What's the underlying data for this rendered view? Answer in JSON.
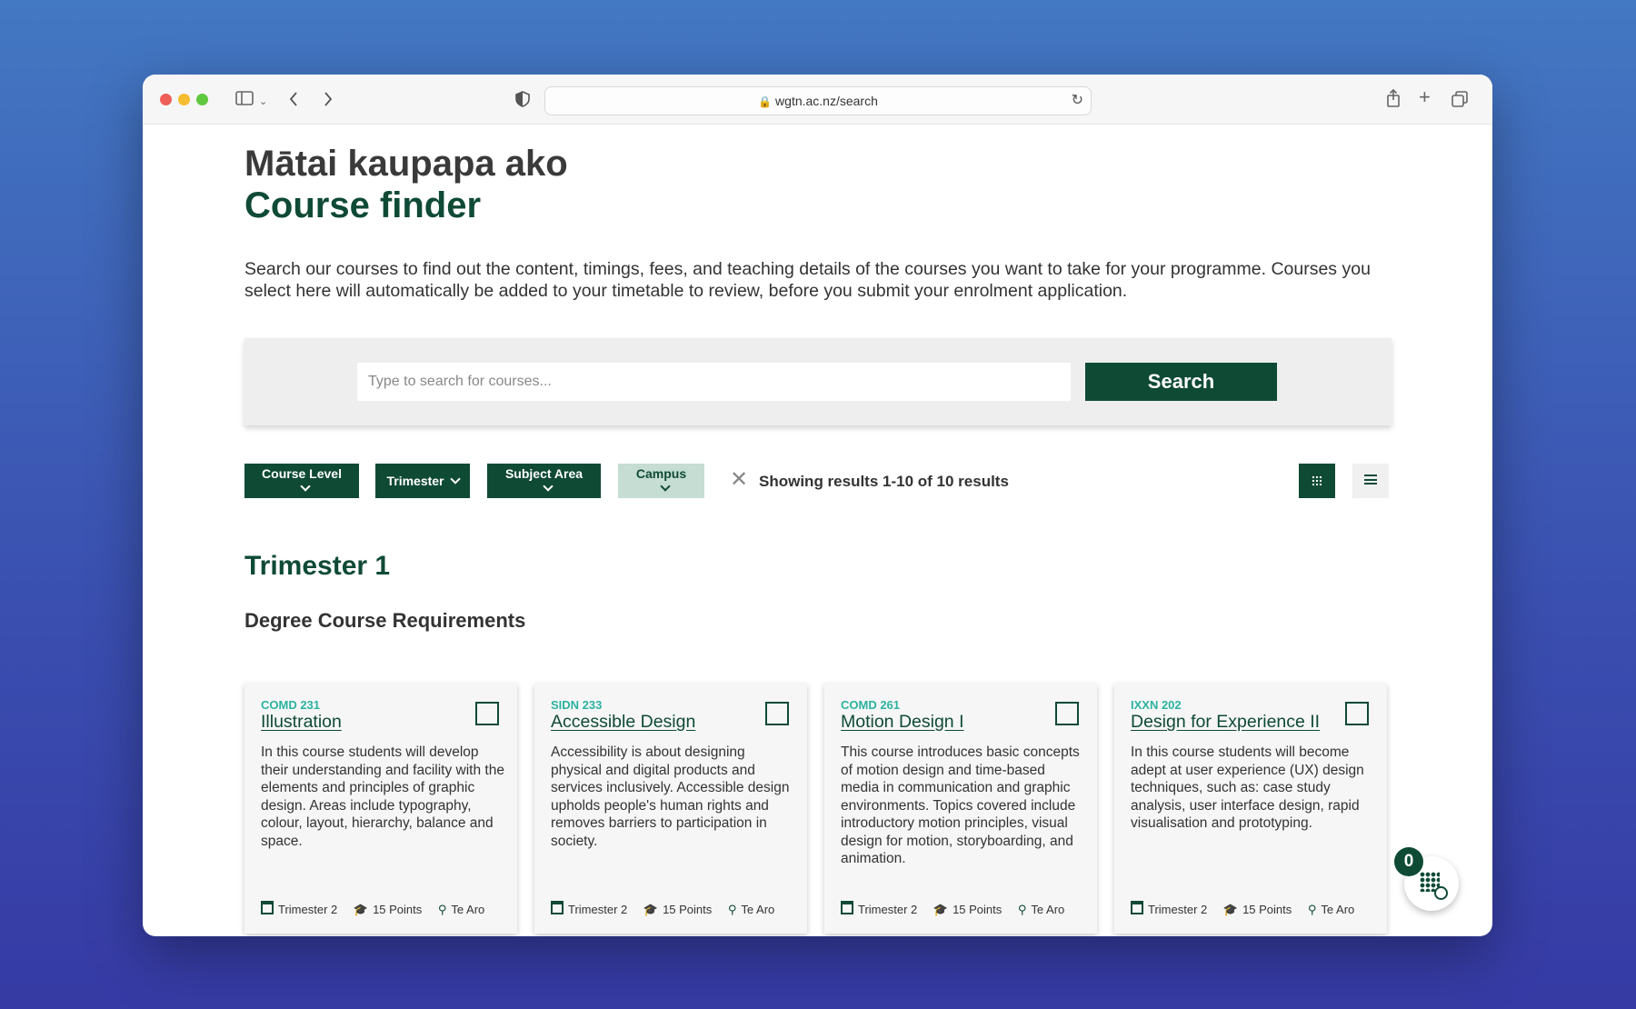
{
  "browser": {
    "url": "wgtn.ac.nz/search"
  },
  "page": {
    "heading_maori": "Mātai kaupapa ako",
    "heading": "Course finder",
    "intro": "Search our courses to find out the content, timings, fees, and teaching details of the courses you want to take for your programme. Courses you select here will automatically be added to your timetable to review, before you submit your enrolment application."
  },
  "search": {
    "placeholder": "Type to search for courses...",
    "button_label": "Search"
  },
  "filters": {
    "items": [
      {
        "label": "Course Level"
      },
      {
        "label": "Trimester"
      },
      {
        "label": "Subject Area"
      },
      {
        "label": "Campus"
      }
    ],
    "results_text": "Showing results 1-10 of 10 results"
  },
  "section": {
    "title": "Trimester 1",
    "subtitle": "Degree Course Requirements"
  },
  "courses": [
    {
      "code": "COMD 231",
      "title": "Illustration",
      "description": "In this course students will develop their understanding and facility with the elements and principles of graphic design. Areas include typography, colour, layout, hierarchy, balance and space.",
      "trimester": "Trimester 2",
      "points": "15 Points",
      "campus": "Te Aro"
    },
    {
      "code": "SIDN 233",
      "title": "Accessible Design",
      "description": "Accessibility is about designing physical and digital products and services inclusively. Accessible design upholds people's human rights  and removes barriers to participation in society.",
      "trimester": "Trimester 2",
      "points": "15 Points",
      "campus": "Te Aro"
    },
    {
      "code": "COMD 261",
      "title": "Motion Design I",
      "description": "This course introduces basic concepts of motion design and time-based media in communication and graphic environments. Topics covered include introductory motion principles, visual design for motion, storyboarding, and animation.",
      "trimester": "Trimester 2",
      "points": "15 Points",
      "campus": "Te Aro"
    },
    {
      "code": "IXXN 202",
      "title": "Design for Experience II",
      "description": "In this course students will become adept at user experience (UX) design techniques, such as: case study analysis, user interface design, rapid visualisation and prototyping.",
      "trimester": "Trimester 2",
      "points": "15 Points",
      "campus": "Te Aro"
    }
  ],
  "timetable": {
    "count": "0"
  },
  "colors": {
    "brand": "#0f4a35",
    "accent": "#2bb2a0",
    "muted_filter": "#c5ddd3"
  }
}
